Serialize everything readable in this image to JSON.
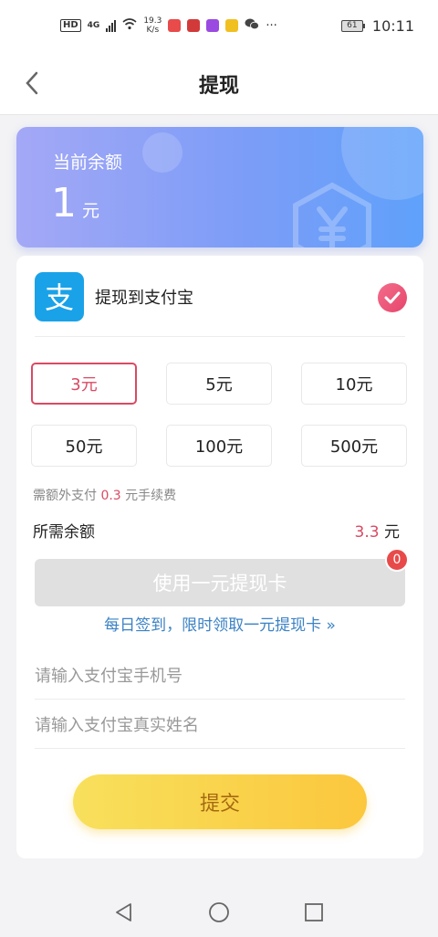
{
  "status_bar": {
    "hd": "HD",
    "network": "4G",
    "speed_value": "19.3",
    "speed_unit": "K/s",
    "more": "···",
    "battery": "61",
    "time": "10:11"
  },
  "header": {
    "title": "提现"
  },
  "balance": {
    "label": "当前余额",
    "amount": "1",
    "unit": "元"
  },
  "payment_method": {
    "logo_char": "支",
    "label": "提现到支付宝"
  },
  "amounts": [
    {
      "label": "3元",
      "selected": true
    },
    {
      "label": "5元",
      "selected": false
    },
    {
      "label": "10元",
      "selected": false
    },
    {
      "label": "50元",
      "selected": false
    },
    {
      "label": "100元",
      "selected": false
    },
    {
      "label": "500元",
      "selected": false
    }
  ],
  "fee": {
    "prefix": "需额外支付",
    "value": "0.3",
    "suffix": "元手续费"
  },
  "required": {
    "label": "所需余额",
    "value": "3.3",
    "unit": "元"
  },
  "card": {
    "button_label": "使用一元提现卡",
    "badge_count": "0",
    "promo_link": "每日签到，限时领取一元提现卡 »"
  },
  "form": {
    "phone_placeholder": "请输入支付宝手机号",
    "phone_value": "",
    "name_placeholder": "请输入支付宝真实姓名",
    "name_value": "",
    "submit_label": "提交"
  },
  "colors": {
    "accent": "#d94a63",
    "link": "#3b82c4",
    "submit": "#fbc73d",
    "alipay": "#1aa2e8"
  }
}
